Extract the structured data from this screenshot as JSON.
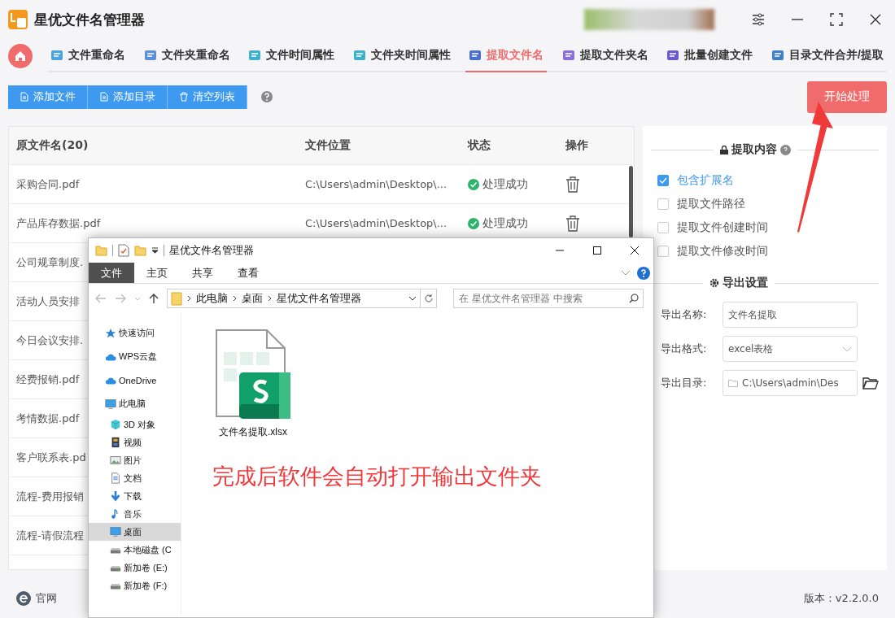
{
  "window": {
    "title": "星优文件名管理器"
  },
  "tabs": [
    {
      "label": "文件重命名",
      "selected": false,
      "color": "#4aa3df"
    },
    {
      "label": "文件夹重命名",
      "selected": false,
      "color": "#5b8fd6"
    },
    {
      "label": "文件时间属性",
      "selected": false,
      "color": "#3fb0c9"
    },
    {
      "label": "文件夹时间属性",
      "selected": false,
      "color": "#3fb0c9"
    },
    {
      "label": "提取文件名",
      "selected": true,
      "color": "#4a6fd0"
    },
    {
      "label": "提取文件夹名",
      "selected": false,
      "color": "#8a6fd8"
    },
    {
      "label": "批量创建文件",
      "selected": false,
      "color": "#6a5acd"
    },
    {
      "label": "目录文件合并/提取",
      "selected": false,
      "color": "#3f7fc9"
    }
  ],
  "toolbar": {
    "buttons": [
      {
        "label": "添加文件",
        "kind": "file"
      },
      {
        "label": "添加目录",
        "kind": "file"
      },
      {
        "label": "清空列表",
        "kind": "trash"
      }
    ],
    "start_button": "开始处理"
  },
  "table": {
    "columns": [
      "原文件名(20)",
      "文件位置",
      "状态",
      "操作"
    ],
    "rows": [
      {
        "name": "采购合同.pdf",
        "location": "C:\\Users\\admin\\Desktop\\...",
        "status": "处理成功"
      },
      {
        "name": "产品库存数据.pdf",
        "location": "C:\\Users\\admin\\Desktop\\...",
        "status": "处理成功"
      },
      {
        "name": "公司规章制度."
      },
      {
        "name": "活动人员安排"
      },
      {
        "name": "今日会议安排."
      },
      {
        "name": "经费报销.pdf"
      },
      {
        "name": "考情数据.pdf"
      },
      {
        "name": "客户联系表.pd"
      },
      {
        "name": "流程-费用报销"
      },
      {
        "name": "流程-请假流程"
      }
    ]
  },
  "panel": {
    "extract_title": "提取内容",
    "options": [
      {
        "label": "包含扩展名",
        "checked": true
      },
      {
        "label": "提取文件路径",
        "checked": false
      },
      {
        "label": "提取文件创建时间",
        "checked": false
      },
      {
        "label": "提取文件修改时间",
        "checked": false
      }
    ],
    "export_title": "导出设置",
    "fields": [
      {
        "label": "导出名称:",
        "value": "文件名提取",
        "kind": "text"
      },
      {
        "label": "导出格式:",
        "value": "excel表格",
        "kind": "select"
      },
      {
        "label": "导出目录:",
        "value": "C:\\Users\\admin\\Des",
        "kind": "folder"
      }
    ]
  },
  "footer": {
    "link": "官网",
    "version": "版本：v2.2.0.0"
  },
  "explorer": {
    "title": "星优文件名管理器",
    "ribbon": [
      {
        "label": "文件",
        "selected": true
      },
      {
        "label": "主页",
        "selected": false
      },
      {
        "label": "共享",
        "selected": false
      },
      {
        "label": "查看",
        "selected": false
      }
    ],
    "breadcrumb": [
      "此电脑",
      "桌面",
      "星优文件名管理器"
    ],
    "search": {
      "placeholder": "在 星优文件名管理器 中搜索"
    },
    "nav": [
      {
        "label": "快速访问",
        "kind": "star",
        "selected": false
      },
      {
        "label": "WPS云盘",
        "kind": "cloud",
        "selected": false
      },
      {
        "label": "OneDrive",
        "kind": "cloud",
        "selected": false
      },
      {
        "label": "此电脑",
        "kind": "monitor",
        "selected": false,
        "children": [
          {
            "label": "3D 对象",
            "kind": "cube",
            "selected": false
          },
          {
            "label": "视频",
            "kind": "film",
            "selected": false
          },
          {
            "label": "图片",
            "kind": "picture",
            "selected": false
          },
          {
            "label": "文档",
            "kind": "document",
            "selected": false
          },
          {
            "label": "下载",
            "kind": "download",
            "selected": false
          },
          {
            "label": "音乐",
            "kind": "music",
            "selected": false
          },
          {
            "label": "桌面",
            "kind": "monitor",
            "selected": true
          },
          {
            "label": "本地磁盘 (C",
            "kind": "drive",
            "selected": false
          },
          {
            "label": "新加卷 (E:)",
            "kind": "drive",
            "selected": false
          },
          {
            "label": "新加卷 (F:)",
            "kind": "drive",
            "selected": false
          }
        ]
      }
    ],
    "file": {
      "name": "文件名提取.xlsx"
    },
    "note": "完成后软件会自动打开输出文件夹"
  }
}
